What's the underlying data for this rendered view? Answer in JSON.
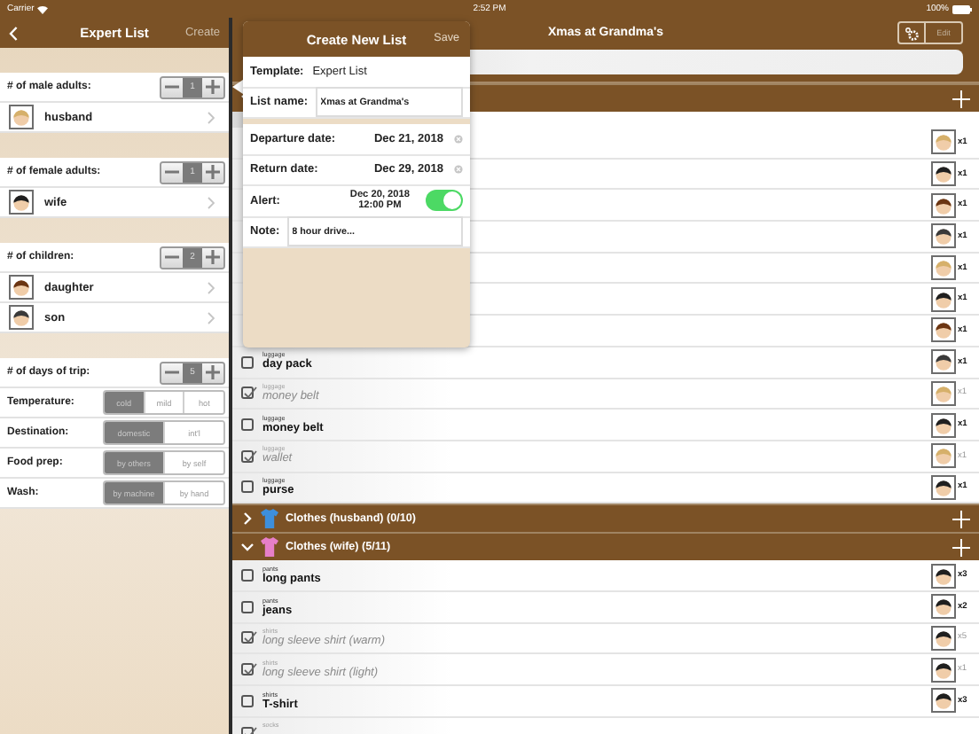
{
  "status_bar": {
    "carrier": "Carrier",
    "time": "2:52 PM",
    "battery": "100%"
  },
  "setup": {
    "title": "Expert List",
    "action": "Create",
    "groups": [
      {
        "label": "# of male adults:",
        "count": "1",
        "members": [
          {
            "name": "husband",
            "color": "#d6b06a"
          }
        ]
      },
      {
        "label": "# of female adults:",
        "count": "1",
        "members": [
          {
            "name": "wife",
            "color": "#1f1f1f"
          }
        ]
      },
      {
        "label": "# of children:",
        "count": "2",
        "members": [
          {
            "name": "daughter",
            "color": "#6b3512"
          },
          {
            "name": "son",
            "color": "#3a3a3a"
          }
        ]
      }
    ],
    "settings": [
      {
        "kind": "stepper",
        "label": "# of days of trip:",
        "count": "5"
      },
      {
        "kind": "segmented",
        "label": "Temperature:",
        "options": [
          {
            "label": "cold",
            "selected": true
          },
          {
            "label": "mild",
            "selected": false
          },
          {
            "label": "hot",
            "selected": false
          }
        ]
      },
      {
        "kind": "segmented",
        "label": "Destination:",
        "options": [
          {
            "label": "domestic",
            "selected": true
          },
          {
            "label": "int'l",
            "selected": false
          }
        ]
      },
      {
        "kind": "segmented",
        "label": "Food prep:",
        "options": [
          {
            "label": "by others",
            "selected": true
          },
          {
            "label": "by self",
            "selected": false
          }
        ]
      },
      {
        "kind": "segmented",
        "label": "Wash:",
        "options": [
          {
            "label": "by machine",
            "selected": true
          },
          {
            "label": "by hand",
            "selected": false
          }
        ]
      }
    ]
  },
  "list": {
    "title": "Xmas at Grandma's",
    "edit": "Edit",
    "rows": [
      {
        "kind": "section",
        "expanded": true
      },
      {
        "kind": "item",
        "color": "#d6b06a",
        "count": "x1"
      },
      {
        "kind": "item",
        "color": "#1f1f1f",
        "count": "x1"
      },
      {
        "kind": "item",
        "color": "#6b3512",
        "count": "x1"
      },
      {
        "kind": "item",
        "color": "#3a3a3a",
        "count": "x1"
      },
      {
        "kind": "item",
        "color": "#d6b06a",
        "count": "x1"
      },
      {
        "kind": "item",
        "color": "#1f1f1f",
        "count": "x1"
      },
      {
        "kind": "item",
        "color": "#6b3512",
        "count": "x1"
      },
      {
        "kind": "item",
        "category": "luggage",
        "name": "day pack",
        "checked": false,
        "color": "#3a3a3a",
        "count": "x1"
      },
      {
        "kind": "item",
        "category": "luggage",
        "name": "money belt",
        "checked": true,
        "color": "#d6b06a",
        "count": "x1"
      },
      {
        "kind": "item",
        "category": "luggage",
        "name": "money belt",
        "checked": false,
        "color": "#1f1f1f",
        "count": "x1"
      },
      {
        "kind": "item",
        "category": "luggage",
        "name": "wallet",
        "checked": true,
        "color": "#d6b06a",
        "count": "x1"
      },
      {
        "kind": "item",
        "category": "luggage",
        "name": "purse",
        "checked": false,
        "color": "#1f1f1f",
        "count": "x1"
      },
      {
        "kind": "section",
        "title": "Clothes (husband) (0/10)",
        "expanded": false,
        "color": "#3d8fdc"
      },
      {
        "kind": "section",
        "title": "Clothes (wife) (5/11)",
        "expanded": true,
        "color": "#e77fc9"
      },
      {
        "kind": "item",
        "category": "pants",
        "name": "long pants",
        "checked": false,
        "color": "#1f1f1f",
        "count": "x3"
      },
      {
        "kind": "item",
        "category": "pants",
        "name": "jeans",
        "checked": false,
        "color": "#1f1f1f",
        "count": "x2"
      },
      {
        "kind": "item",
        "category": "shirts",
        "name": "long sleeve shirt (warm)",
        "checked": true,
        "color": "#1f1f1f",
        "count": "x5"
      },
      {
        "kind": "item",
        "category": "shirts",
        "name": "long sleeve shirt (light)",
        "checked": true,
        "color": "#1f1f1f",
        "count": "x1"
      },
      {
        "kind": "item",
        "category": "shirts",
        "name": "T-shirt",
        "checked": false,
        "color": "#1f1f1f",
        "count": "x3"
      },
      {
        "kind": "item",
        "category": "socks",
        "checked": true
      }
    ]
  },
  "popover": {
    "title": "Create New List",
    "save": "Save",
    "sections": [
      [
        {
          "kind": "text",
          "label": "Template:",
          "value": "Expert List"
        },
        {
          "kind": "input",
          "label": "List name:",
          "value": "Xmas at Grandma's"
        }
      ],
      [
        {
          "kind": "date",
          "label": "Departure date:",
          "value": "Dec 21, 2018"
        },
        {
          "kind": "date",
          "label": "Return date:",
          "value": "Dec 29, 2018"
        },
        {
          "kind": "toggle",
          "label": "Alert:",
          "date": "Dec 20, 2018",
          "time": "12:00 PM",
          "on": true
        },
        {
          "kind": "input",
          "label": "Note:",
          "value": "8 hour drive..."
        }
      ]
    ]
  }
}
